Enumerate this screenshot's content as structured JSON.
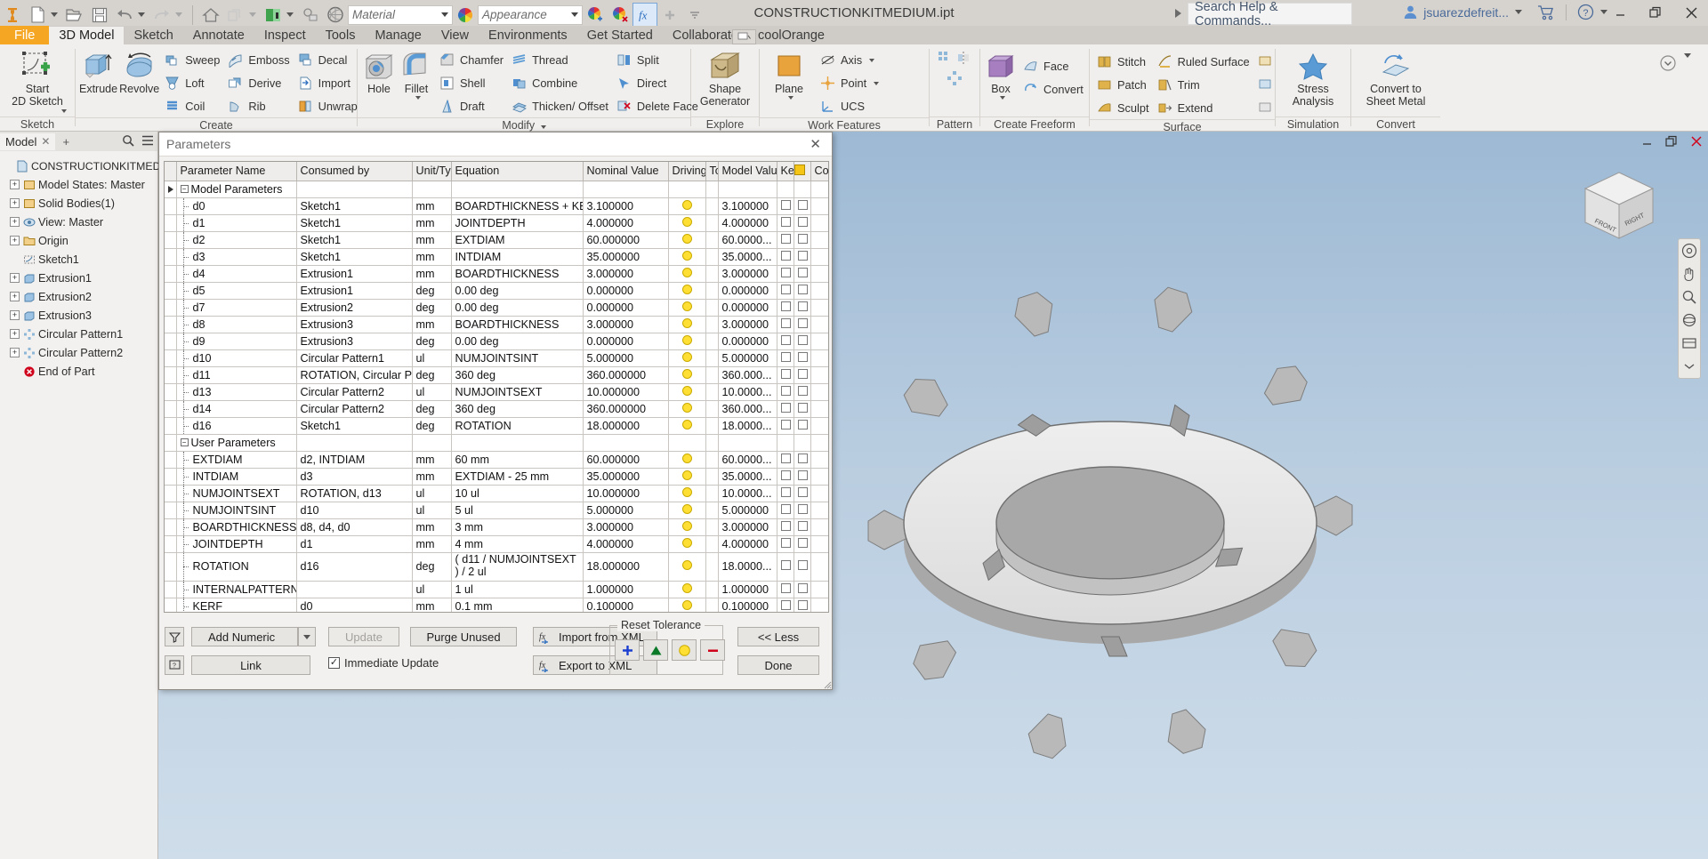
{
  "app": {
    "title": "CONSTRUCTIONKITMEDIUM.ipt",
    "material_placeholder": "Material",
    "appearance_placeholder": "Appearance",
    "search_placeholder": "Search Help & Commands...",
    "user_name": "jsuarezdefreit...",
    "minimize": "–",
    "restore": "❐",
    "close": "✕"
  },
  "tabs": [
    {
      "label": "File",
      "state": "file"
    },
    {
      "label": "3D Model",
      "state": "active"
    },
    {
      "label": "Sketch",
      "state": ""
    },
    {
      "label": "Annotate",
      "state": ""
    },
    {
      "label": "Inspect",
      "state": ""
    },
    {
      "label": "Tools",
      "state": ""
    },
    {
      "label": "Manage",
      "state": ""
    },
    {
      "label": "View",
      "state": ""
    },
    {
      "label": "Environments",
      "state": ""
    },
    {
      "label": "Get Started",
      "state": ""
    },
    {
      "label": "Collaborate",
      "state": ""
    },
    {
      "label": "coolOrange",
      "state": ""
    }
  ],
  "ribbon": {
    "groups": [
      {
        "name": "Sketch",
        "label": "Sketch",
        "big": [
          {
            "label": "Start\n2D Sketch",
            "icon": "start-2d-sketch-icon"
          }
        ],
        "cols": []
      },
      {
        "name": "Create",
        "label": "Create",
        "big": [
          {
            "label": "Extrude",
            "icon": "extrude-icon"
          },
          {
            "label": "Revolve",
            "icon": "revolve-icon"
          }
        ],
        "cols": [
          [
            {
              "label": "Sweep",
              "icon": "sweep-icon"
            },
            {
              "label": "Loft",
              "icon": "loft-icon"
            },
            {
              "label": "Coil",
              "icon": "coil-icon"
            }
          ],
          [
            {
              "label": "Emboss",
              "icon": "emboss-icon"
            },
            {
              "label": "Derive",
              "icon": "derive-icon"
            },
            {
              "label": "Rib",
              "icon": "rib-icon"
            }
          ],
          [
            {
              "label": "Decal",
              "icon": "decal-icon"
            },
            {
              "label": "Import",
              "icon": "import-icon"
            },
            {
              "label": "Unwrap",
              "icon": "unwrap-icon"
            }
          ]
        ]
      },
      {
        "name": "Modify",
        "label": "Modify",
        "big": [
          {
            "label": "Hole",
            "icon": "hole-icon"
          },
          {
            "label": "Fillet",
            "icon": "fillet-icon"
          }
        ],
        "cols": [
          [
            {
              "label": "Chamfer",
              "icon": "chamfer-icon"
            },
            {
              "label": "Shell",
              "icon": "shell-icon"
            },
            {
              "label": "Draft",
              "icon": "draft-icon"
            }
          ],
          [
            {
              "label": "Thread",
              "icon": "thread-icon"
            },
            {
              "label": "Combine",
              "icon": "combine-icon"
            },
            {
              "label": "Thicken/ Offset",
              "icon": "thicken-offset-icon"
            }
          ],
          [
            {
              "label": "Split",
              "icon": "split-icon"
            },
            {
              "label": "Direct",
              "icon": "direct-icon"
            },
            {
              "label": "Delete Face",
              "icon": "delete-face-icon"
            }
          ]
        ]
      },
      {
        "name": "Explore",
        "label": "Explore",
        "big": [
          {
            "label": "Shape\nGenerator",
            "icon": "shape-generator-icon"
          }
        ],
        "cols": []
      },
      {
        "name": "Work Features",
        "label": "Work Features",
        "big": [
          {
            "label": "Plane",
            "icon": "plane-icon"
          }
        ],
        "cols": [
          [
            {
              "label": "Axis",
              "icon": "axis-icon"
            },
            {
              "label": "Point",
              "icon": "point-icon"
            },
            {
              "label": "UCS",
              "icon": "ucs-icon"
            }
          ]
        ]
      },
      {
        "name": "Pattern",
        "label": "Pattern",
        "big": [],
        "cols": []
      },
      {
        "name": "Create Freeform",
        "label": "Create Freeform",
        "big": [
          {
            "label": "Box",
            "icon": "box-icon"
          }
        ],
        "cols": [
          [
            {
              "label": "Face",
              "icon": "face-icon"
            },
            {
              "label": "Convert",
              "icon": "convert-freeform-icon"
            }
          ]
        ]
      },
      {
        "name": "Surface",
        "label": "Surface",
        "big": [],
        "cols": [
          [
            {
              "label": "Stitch",
              "icon": "stitch-icon"
            },
            {
              "label": "Patch",
              "icon": "patch-icon"
            },
            {
              "label": "Sculpt",
              "icon": "sculpt-icon"
            }
          ],
          [
            {
              "label": "Ruled Surface",
              "icon": "ruled-surface-icon"
            },
            {
              "label": "Trim",
              "icon": "trim-icon"
            },
            {
              "label": "Extend",
              "icon": "extend-icon"
            }
          ]
        ]
      },
      {
        "name": "Simulation",
        "label": "Simulation",
        "big": [
          {
            "label": "Stress\nAnalysis",
            "icon": "stress-analysis-icon"
          }
        ],
        "cols": []
      },
      {
        "name": "Convert",
        "label": "Convert",
        "big": [
          {
            "label": "Convert to\nSheet Metal",
            "icon": "convert-sheet-metal-icon"
          }
        ],
        "cols": []
      }
    ]
  },
  "browser": {
    "tab_label": "Model",
    "root": "CONSTRUCTIONKITMEDIUM.ipt",
    "items": [
      {
        "label": "Model States: Master",
        "icon": "model-states-icon",
        "exp": "+",
        "depth": 1
      },
      {
        "label": "Solid Bodies(1)",
        "icon": "solid-bodies-icon",
        "exp": "+",
        "depth": 1
      },
      {
        "label": "View: Master",
        "icon": "view-icon",
        "exp": "+",
        "depth": 1
      },
      {
        "label": "Origin",
        "icon": "origin-folder-icon",
        "exp": "+",
        "depth": 1
      },
      {
        "label": "Sketch1",
        "icon": "sketch-icon",
        "exp": "",
        "depth": 1
      },
      {
        "label": "Extrusion1",
        "icon": "extrusion-icon",
        "exp": "+",
        "depth": 1
      },
      {
        "label": "Extrusion2",
        "icon": "extrusion-icon",
        "exp": "+",
        "depth": 1
      },
      {
        "label": "Extrusion3",
        "icon": "extrusion-icon",
        "exp": "+",
        "depth": 1
      },
      {
        "label": "Circular Pattern1",
        "icon": "circular-pattern-icon",
        "exp": "+",
        "depth": 1
      },
      {
        "label": "Circular Pattern2",
        "icon": "circular-pattern-icon",
        "exp": "+",
        "depth": 1
      },
      {
        "label": "End of Part",
        "icon": "end-of-part-icon",
        "exp": "",
        "depth": 1
      }
    ]
  },
  "dialog": {
    "title": "Parameters",
    "columns": [
      "Parameter Name",
      "Consumed by",
      "Unit/Typ",
      "Equation",
      "Nominal Value",
      "Driving",
      "To",
      "Model Valu",
      "Ke",
      "",
      "Co"
    ],
    "groups": [
      {
        "name": "Model Parameters",
        "rows": [
          {
            "name": "d0",
            "consumed": "Sketch1",
            "unit": "mm",
            "equation": "BOARDTHICKNESS + KERF",
            "nominal": "3.100000",
            "model": "3.100000"
          },
          {
            "name": "d1",
            "consumed": "Sketch1",
            "unit": "mm",
            "equation": "JOINTDEPTH",
            "nominal": "4.000000",
            "model": "4.000000"
          },
          {
            "name": "d2",
            "consumed": "Sketch1",
            "unit": "mm",
            "equation": "EXTDIAM",
            "nominal": "60.000000",
            "model": "60.0000..."
          },
          {
            "name": "d3",
            "consumed": "Sketch1",
            "unit": "mm",
            "equation": "INTDIAM",
            "nominal": "35.000000",
            "model": "35.0000..."
          },
          {
            "name": "d4",
            "consumed": "Extrusion1",
            "unit": "mm",
            "equation": "BOARDTHICKNESS",
            "nominal": "3.000000",
            "model": "3.000000"
          },
          {
            "name": "d5",
            "consumed": "Extrusion1",
            "unit": "deg",
            "equation": "0.00 deg",
            "nominal": "0.000000",
            "model": "0.000000"
          },
          {
            "name": "d7",
            "consumed": "Extrusion2",
            "unit": "deg",
            "equation": "0.00 deg",
            "nominal": "0.000000",
            "model": "0.000000"
          },
          {
            "name": "d8",
            "consumed": "Extrusion3",
            "unit": "mm",
            "equation": "BOARDTHICKNESS",
            "nominal": "3.000000",
            "model": "3.000000"
          },
          {
            "name": "d9",
            "consumed": "Extrusion3",
            "unit": "deg",
            "equation": "0.00 deg",
            "nominal": "0.000000",
            "model": "0.000000"
          },
          {
            "name": "d10",
            "consumed": "Circular Pattern1",
            "unit": "ul",
            "equation": "NUMJOINTSINT",
            "nominal": "5.000000",
            "model": "5.000000"
          },
          {
            "name": "d11",
            "consumed": "ROTATION, Circular Patte...",
            "unit": "deg",
            "equation": "360 deg",
            "nominal": "360.000000",
            "model": "360.000..."
          },
          {
            "name": "d13",
            "consumed": "Circular Pattern2",
            "unit": "ul",
            "equation": "NUMJOINTSEXT",
            "nominal": "10.000000",
            "model": "10.0000..."
          },
          {
            "name": "d14",
            "consumed": "Circular Pattern2",
            "unit": "deg",
            "equation": "360 deg",
            "nominal": "360.000000",
            "model": "360.000..."
          },
          {
            "name": "d16",
            "consumed": "Sketch1",
            "unit": "deg",
            "equation": "ROTATION",
            "nominal": "18.000000",
            "model": "18.0000..."
          }
        ]
      },
      {
        "name": "User Parameters",
        "rows": [
          {
            "name": "EXTDIAM",
            "consumed": "d2, INTDIAM",
            "unit": "mm",
            "equation": "60 mm",
            "nominal": "60.000000",
            "model": "60.0000..."
          },
          {
            "name": "INTDIAM",
            "consumed": "d3",
            "unit": "mm",
            "equation": "EXTDIAM - 25 mm",
            "nominal": "35.000000",
            "model": "35.0000..."
          },
          {
            "name": "NUMJOINTSEXT",
            "consumed": "ROTATION, d13",
            "unit": "ul",
            "equation": "10 ul",
            "nominal": "10.000000",
            "model": "10.0000..."
          },
          {
            "name": "NUMJOINTSINT",
            "consumed": "d10",
            "unit": "ul",
            "equation": "5 ul",
            "nominal": "5.000000",
            "model": "5.000000"
          },
          {
            "name": "BOARDTHICKNESS",
            "consumed": "d8, d4, d0",
            "unit": "mm",
            "equation": "3 mm",
            "nominal": "3.000000",
            "model": "3.000000"
          },
          {
            "name": "JOINTDEPTH",
            "consumed": "d1",
            "unit": "mm",
            "equation": "4 mm",
            "nominal": "4.000000",
            "model": "4.000000"
          },
          {
            "name": "ROTATION",
            "consumed": "d16",
            "unit": "deg",
            "equation": "( d11 / NUMJOINTSEXT ) / 2 ul",
            "nominal": "18.000000",
            "model": "18.0000...",
            "tall": true
          },
          {
            "name": "INTERNALPATTERN",
            "consumed": "",
            "unit": "ul",
            "equation": "1 ul",
            "nominal": "1.000000",
            "model": "1.000000"
          },
          {
            "name": "KERF",
            "consumed": "d0",
            "unit": "mm",
            "equation": "0.1 mm",
            "nominal": "0.100000",
            "model": "0.100000"
          }
        ]
      }
    ],
    "buttons": {
      "add_numeric": "Add Numeric",
      "update": "Update",
      "purge_unused": "Purge Unused",
      "import_xml": "Import from XML",
      "link": "Link",
      "immediate_update": "Immediate Update",
      "export_xml": "Export to XML",
      "reset_tolerance": "Reset Tolerance",
      "less": "<< Less",
      "done": "Done"
    }
  },
  "viewcube": {
    "front": "FRONT",
    "right": "RIGHT"
  }
}
